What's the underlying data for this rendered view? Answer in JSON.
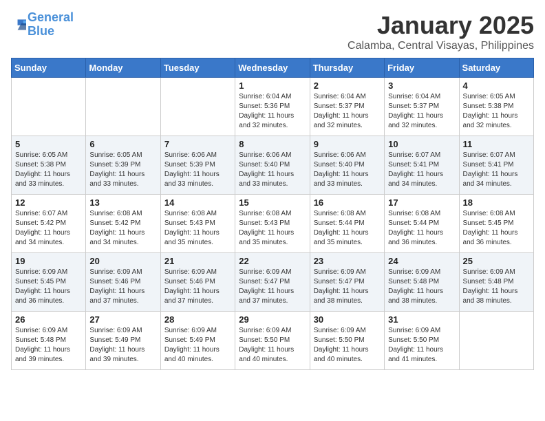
{
  "logo": {
    "line1": "General",
    "line2": "Blue"
  },
  "title": "January 2025",
  "location": "Calamba, Central Visayas, Philippines",
  "days_of_week": [
    "Sunday",
    "Monday",
    "Tuesday",
    "Wednesday",
    "Thursday",
    "Friday",
    "Saturday"
  ],
  "weeks": [
    {
      "shaded": false,
      "cells": [
        {
          "day": "",
          "info": ""
        },
        {
          "day": "",
          "info": ""
        },
        {
          "day": "",
          "info": ""
        },
        {
          "day": "1",
          "info": "Sunrise: 6:04 AM\nSunset: 5:36 PM\nDaylight: 11 hours\nand 32 minutes."
        },
        {
          "day": "2",
          "info": "Sunrise: 6:04 AM\nSunset: 5:37 PM\nDaylight: 11 hours\nand 32 minutes."
        },
        {
          "day": "3",
          "info": "Sunrise: 6:04 AM\nSunset: 5:37 PM\nDaylight: 11 hours\nand 32 minutes."
        },
        {
          "day": "4",
          "info": "Sunrise: 6:05 AM\nSunset: 5:38 PM\nDaylight: 11 hours\nand 32 minutes."
        }
      ]
    },
    {
      "shaded": true,
      "cells": [
        {
          "day": "5",
          "info": "Sunrise: 6:05 AM\nSunset: 5:38 PM\nDaylight: 11 hours\nand 33 minutes."
        },
        {
          "day": "6",
          "info": "Sunrise: 6:05 AM\nSunset: 5:39 PM\nDaylight: 11 hours\nand 33 minutes."
        },
        {
          "day": "7",
          "info": "Sunrise: 6:06 AM\nSunset: 5:39 PM\nDaylight: 11 hours\nand 33 minutes."
        },
        {
          "day": "8",
          "info": "Sunrise: 6:06 AM\nSunset: 5:40 PM\nDaylight: 11 hours\nand 33 minutes."
        },
        {
          "day": "9",
          "info": "Sunrise: 6:06 AM\nSunset: 5:40 PM\nDaylight: 11 hours\nand 33 minutes."
        },
        {
          "day": "10",
          "info": "Sunrise: 6:07 AM\nSunset: 5:41 PM\nDaylight: 11 hours\nand 34 minutes."
        },
        {
          "day": "11",
          "info": "Sunrise: 6:07 AM\nSunset: 5:41 PM\nDaylight: 11 hours\nand 34 minutes."
        }
      ]
    },
    {
      "shaded": false,
      "cells": [
        {
          "day": "12",
          "info": "Sunrise: 6:07 AM\nSunset: 5:42 PM\nDaylight: 11 hours\nand 34 minutes."
        },
        {
          "day": "13",
          "info": "Sunrise: 6:08 AM\nSunset: 5:42 PM\nDaylight: 11 hours\nand 34 minutes."
        },
        {
          "day": "14",
          "info": "Sunrise: 6:08 AM\nSunset: 5:43 PM\nDaylight: 11 hours\nand 35 minutes."
        },
        {
          "day": "15",
          "info": "Sunrise: 6:08 AM\nSunset: 5:43 PM\nDaylight: 11 hours\nand 35 minutes."
        },
        {
          "day": "16",
          "info": "Sunrise: 6:08 AM\nSunset: 5:44 PM\nDaylight: 11 hours\nand 35 minutes."
        },
        {
          "day": "17",
          "info": "Sunrise: 6:08 AM\nSunset: 5:44 PM\nDaylight: 11 hours\nand 36 minutes."
        },
        {
          "day": "18",
          "info": "Sunrise: 6:08 AM\nSunset: 5:45 PM\nDaylight: 11 hours\nand 36 minutes."
        }
      ]
    },
    {
      "shaded": true,
      "cells": [
        {
          "day": "19",
          "info": "Sunrise: 6:09 AM\nSunset: 5:45 PM\nDaylight: 11 hours\nand 36 minutes."
        },
        {
          "day": "20",
          "info": "Sunrise: 6:09 AM\nSunset: 5:46 PM\nDaylight: 11 hours\nand 37 minutes."
        },
        {
          "day": "21",
          "info": "Sunrise: 6:09 AM\nSunset: 5:46 PM\nDaylight: 11 hours\nand 37 minutes."
        },
        {
          "day": "22",
          "info": "Sunrise: 6:09 AM\nSunset: 5:47 PM\nDaylight: 11 hours\nand 37 minutes."
        },
        {
          "day": "23",
          "info": "Sunrise: 6:09 AM\nSunset: 5:47 PM\nDaylight: 11 hours\nand 38 minutes."
        },
        {
          "day": "24",
          "info": "Sunrise: 6:09 AM\nSunset: 5:48 PM\nDaylight: 11 hours\nand 38 minutes."
        },
        {
          "day": "25",
          "info": "Sunrise: 6:09 AM\nSunset: 5:48 PM\nDaylight: 11 hours\nand 38 minutes."
        }
      ]
    },
    {
      "shaded": false,
      "cells": [
        {
          "day": "26",
          "info": "Sunrise: 6:09 AM\nSunset: 5:48 PM\nDaylight: 11 hours\nand 39 minutes."
        },
        {
          "day": "27",
          "info": "Sunrise: 6:09 AM\nSunset: 5:49 PM\nDaylight: 11 hours\nand 39 minutes."
        },
        {
          "day": "28",
          "info": "Sunrise: 6:09 AM\nSunset: 5:49 PM\nDaylight: 11 hours\nand 40 minutes."
        },
        {
          "day": "29",
          "info": "Sunrise: 6:09 AM\nSunset: 5:50 PM\nDaylight: 11 hours\nand 40 minutes."
        },
        {
          "day": "30",
          "info": "Sunrise: 6:09 AM\nSunset: 5:50 PM\nDaylight: 11 hours\nand 40 minutes."
        },
        {
          "day": "31",
          "info": "Sunrise: 6:09 AM\nSunset: 5:50 PM\nDaylight: 11 hours\nand 41 minutes."
        },
        {
          "day": "",
          "info": ""
        }
      ]
    }
  ]
}
